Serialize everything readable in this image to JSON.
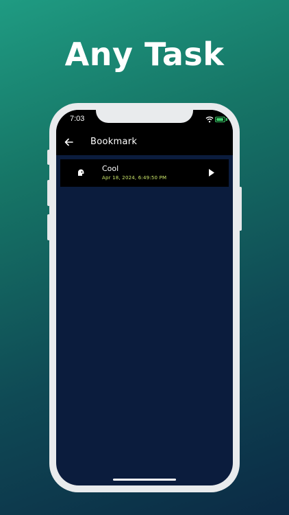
{
  "headline": "Any Task",
  "status_bar": {
    "time": "7:03"
  },
  "app_bar": {
    "title": "Bookmark"
  },
  "bookmarks": [
    {
      "title": "Cool",
      "date": "Apr 18, 2024, 6:49:50 PM"
    }
  ],
  "colors": {
    "accent_date": "#cde86a",
    "screen_background": "#0b1c3d",
    "battery": "#3bd16b"
  },
  "icons": [
    "wifi-icon",
    "battery-icon",
    "back-arrow-icon",
    "bookmark-item-icon",
    "play-icon"
  ]
}
